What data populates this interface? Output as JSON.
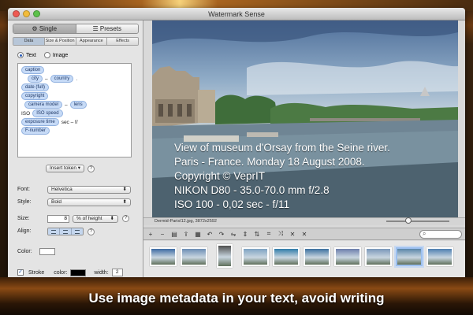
{
  "window": {
    "title": "Watermark Sense"
  },
  "mode": {
    "single": "Single",
    "presets": "Presets",
    "active": "single"
  },
  "tabs": [
    "Data",
    "Size & Position",
    "Appearance",
    "Effects"
  ],
  "content_type": {
    "text": "Text",
    "image": "Image",
    "selected": "text"
  },
  "text_lines": [
    {
      "tokens": [
        "caption"
      ],
      "tail": ""
    },
    {
      "tokens": [
        "city",
        "country"
      ],
      "sep": "–",
      "tail": "."
    },
    {
      "tokens": [
        "date (full)"
      ],
      "tail": ""
    },
    {
      "tokens": [
        "copyright"
      ],
      "tail": ""
    },
    {
      "tokens": [
        "camera model",
        "lens"
      ],
      "sep": "–",
      "tail": ""
    },
    {
      "prefix": "ISO",
      "tokens": [
        "ISO speed"
      ],
      "tail": ""
    },
    {
      "tokens": [
        "exposure time"
      ],
      "tail": "sec – f/"
    },
    {
      "tokens": [
        "F-number"
      ],
      "tail": ""
    }
  ],
  "insert_token": "Insert token",
  "font": {
    "label": "Font:",
    "value": "Helvetica"
  },
  "style": {
    "label": "Style:",
    "value": "Bold"
  },
  "size": {
    "label": "Size:",
    "value": "8",
    "unit": "% of height"
  },
  "align": {
    "label": "Align:"
  },
  "color": {
    "label": "Color:",
    "value": "#ffffff"
  },
  "stroke": {
    "label": "Stroke",
    "color_label": "color:",
    "color_value": "#000000",
    "width_label": "width:",
    "width_value": "2",
    "checked": true
  },
  "overlay_lines": [
    "View of museum d'Orsay from the Seine river.",
    "Paris - France.  Monday 18 August 2008.",
    "Copyright © VeprIT",
    "NIKON D80 - 35.0-70.0 mm f/2.8",
    "ISO 100 - 0,02 sec - f/11"
  ],
  "infobar": "Dermid-ParisI12.jpg, 3872x2592",
  "thumb_colors": [
    "#3c6aa2",
    "#6b8db4",
    "#4e4e4e",
    "#7ea2c2",
    "#2f7ba8",
    "#3b6f9e",
    "#6b7dab",
    "#7996b8",
    "#5a86a8",
    "#4d7eb0"
  ],
  "banner": "Use image metadata in your text, avoid writing"
}
